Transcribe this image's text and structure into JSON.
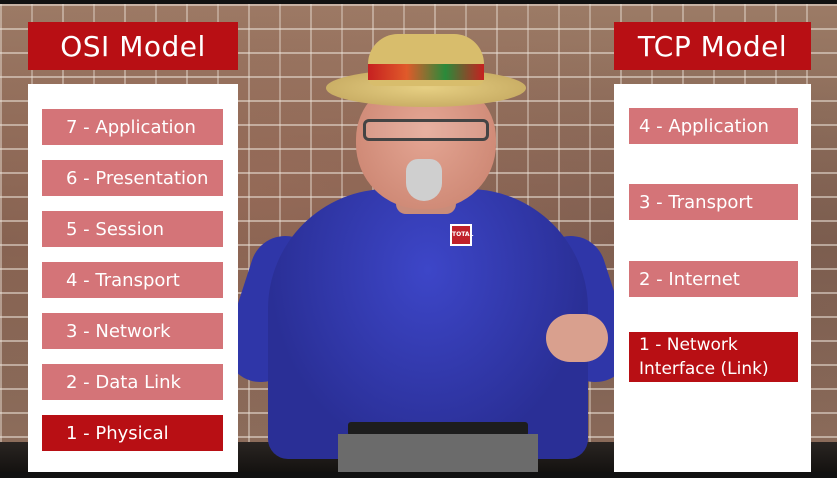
{
  "osi": {
    "title": "OSI Model",
    "layers": [
      {
        "label": "7 - Application",
        "active": false
      },
      {
        "label": "6 - Presentation",
        "active": false
      },
      {
        "label": "5 - Session",
        "active": false
      },
      {
        "label": "4 - Transport",
        "active": false
      },
      {
        "label": "3 - Network",
        "active": false
      },
      {
        "label": "2 - Data Link",
        "active": false
      },
      {
        "label": "1 - Physical",
        "active": true
      }
    ]
  },
  "tcp": {
    "title": "TCP Model",
    "layers": [
      {
        "label": "4 - Application",
        "active": false
      },
      {
        "label": "3 - Transport",
        "active": false
      },
      {
        "label": "2 - Internet",
        "active": false
      },
      {
        "label": "1 - Network\nInterface (Link)",
        "active": true
      }
    ]
  },
  "presenter": {
    "shirt_logo": "TOTAL"
  },
  "colors": {
    "accent_red": "#b80f14",
    "layer_pink": "#d47478",
    "panel_bg": "#ffffff"
  }
}
